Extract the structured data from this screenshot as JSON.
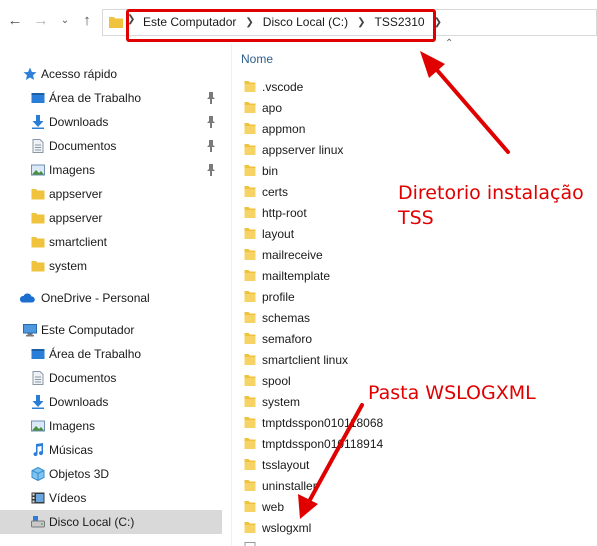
{
  "addressbar": {
    "crumbs": [
      "Este Computador",
      "Disco Local (C:)",
      "TSS2310"
    ]
  },
  "file_list": {
    "column_name": "Nome",
    "items": [
      ".vscode",
      "apo",
      "appmon",
      "appserver linux",
      "bin",
      "certs",
      "http-root",
      "layout",
      "mailreceive",
      "mailtemplate",
      "profile",
      "schemas",
      "semaforo",
      "smartclient linux",
      "spool",
      "system",
      "tmptdsspon010118068",
      "tmptdsspon010118914",
      "tsslayout",
      "uninstaller",
      "web",
      "wslogxml"
    ]
  },
  "sidebar": {
    "quick_access": {
      "label": "Acesso rápido",
      "items": [
        {
          "label": "Área de Trabalho",
          "icon": "desktop-icon",
          "pinned": true
        },
        {
          "label": "Downloads",
          "icon": "downloads-icon",
          "pinned": true
        },
        {
          "label": "Documentos",
          "icon": "documents-icon",
          "pinned": true
        },
        {
          "label": "Imagens",
          "icon": "pictures-icon",
          "pinned": true
        },
        {
          "label": "appserver",
          "icon": "folder-icon",
          "pinned": false
        },
        {
          "label": "appserver",
          "icon": "folder-icon",
          "pinned": false
        },
        {
          "label": "smartclient",
          "icon": "folder-icon",
          "pinned": false
        },
        {
          "label": "system",
          "icon": "folder-icon",
          "pinned": false
        }
      ]
    },
    "onedrive": {
      "label": "OneDrive - Personal"
    },
    "this_pc": {
      "label": "Este Computador",
      "items": [
        {
          "label": "Área de Trabalho",
          "icon": "desktop-icon"
        },
        {
          "label": "Documentos",
          "icon": "documents-icon"
        },
        {
          "label": "Downloads",
          "icon": "downloads-icon"
        },
        {
          "label": "Imagens",
          "icon": "pictures-icon"
        },
        {
          "label": "Músicas",
          "icon": "music-icon"
        },
        {
          "label": "Objetos 3D",
          "icon": "3d-objects-icon"
        },
        {
          "label": "Vídeos",
          "icon": "videos-icon"
        },
        {
          "label": "Disco Local (C:)",
          "icon": "drive-icon",
          "selected": true
        }
      ]
    }
  },
  "annotations": {
    "install_dir": [
      "Diretorio instalação",
      "TSS"
    ],
    "folder": "Pasta WSLOGXML"
  },
  "colors": {
    "annotation_red": "#e00000",
    "folder_yellow": "#f0c33c",
    "selected_bg": "#d9d9d9",
    "header_blue": "#2e5e8e"
  }
}
